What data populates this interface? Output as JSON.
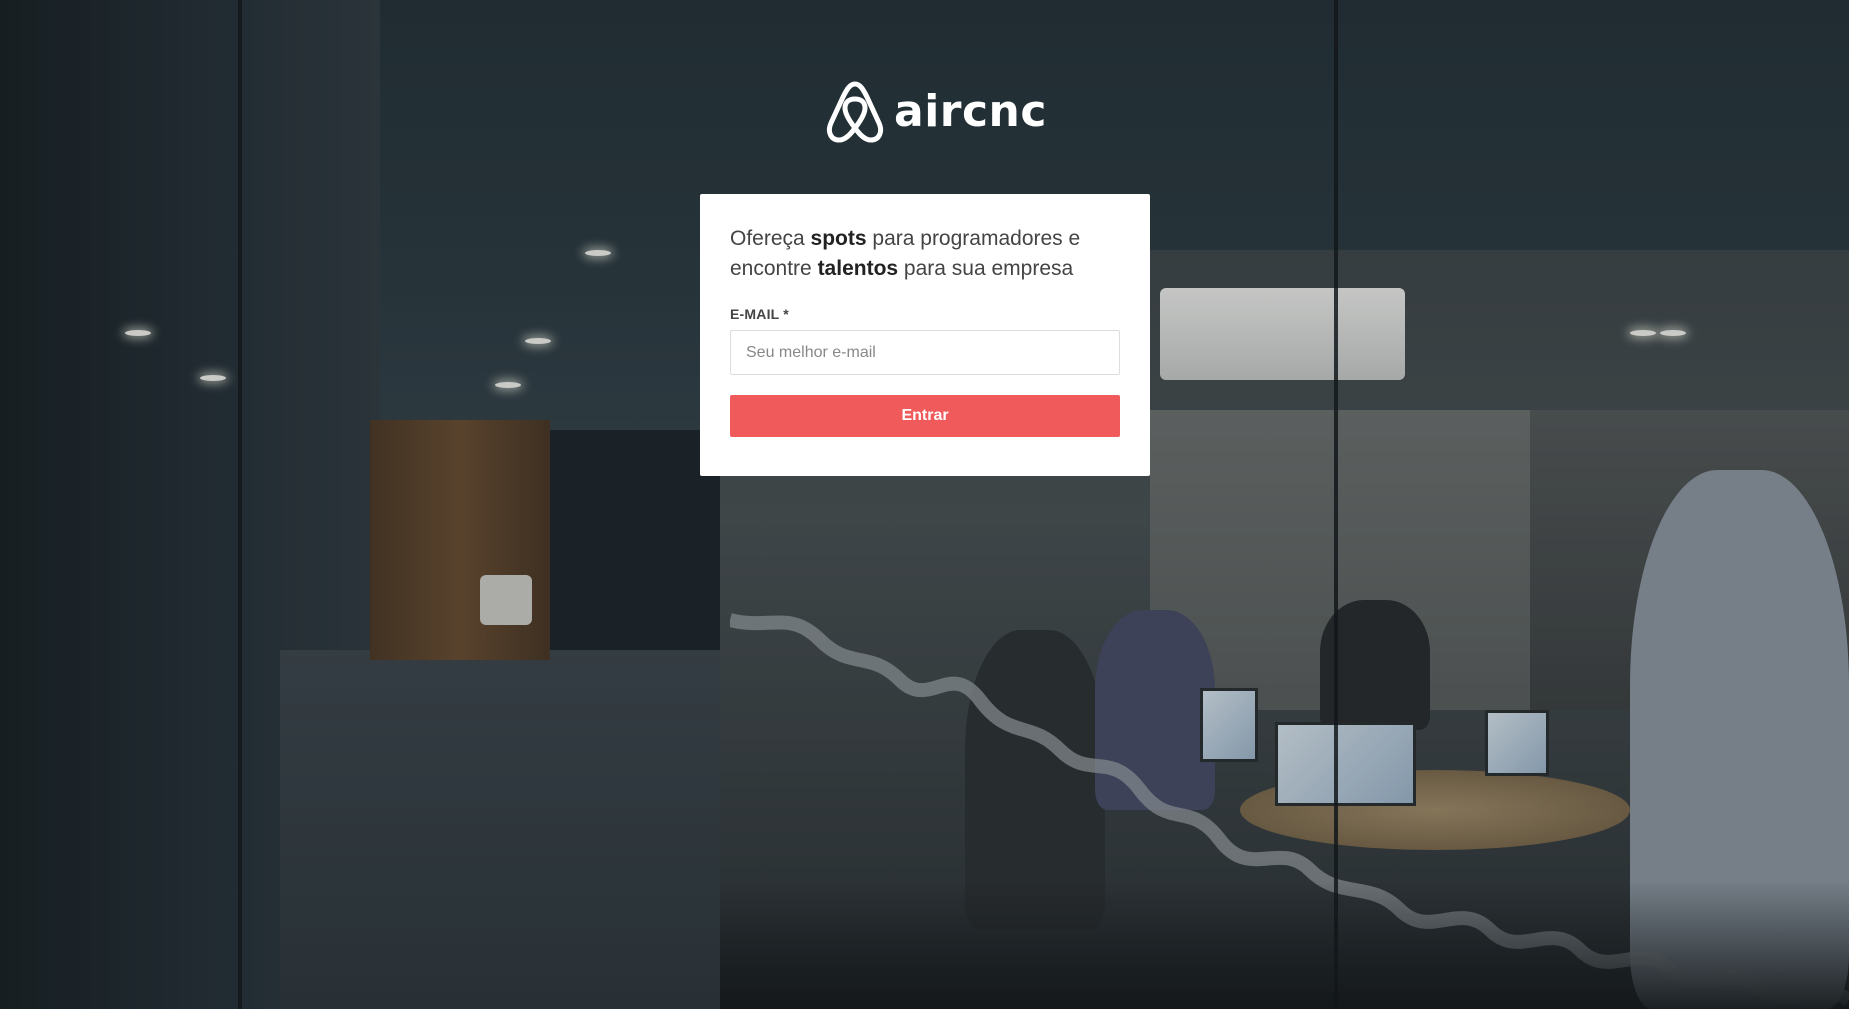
{
  "app": {
    "brand_name": "aircnc",
    "logo_icon": "airbnb-belo-icon",
    "brand_color": "#f05a5b"
  },
  "background": {
    "description_icon": "office-meeting-photo"
  },
  "login_card": {
    "headline_parts": [
      {
        "text": "Ofereça ",
        "bold": false
      },
      {
        "text": "spots",
        "bold": true
      },
      {
        "text": " para programadores e encontre ",
        "bold": false
      },
      {
        "text": "talentos",
        "bold": true
      },
      {
        "text": " para sua empresa",
        "bold": false
      }
    ],
    "email_label": "E-MAIL *",
    "email_placeholder": "Seu melhor e-mail",
    "email_value": "",
    "submit_label": "Entrar"
  }
}
